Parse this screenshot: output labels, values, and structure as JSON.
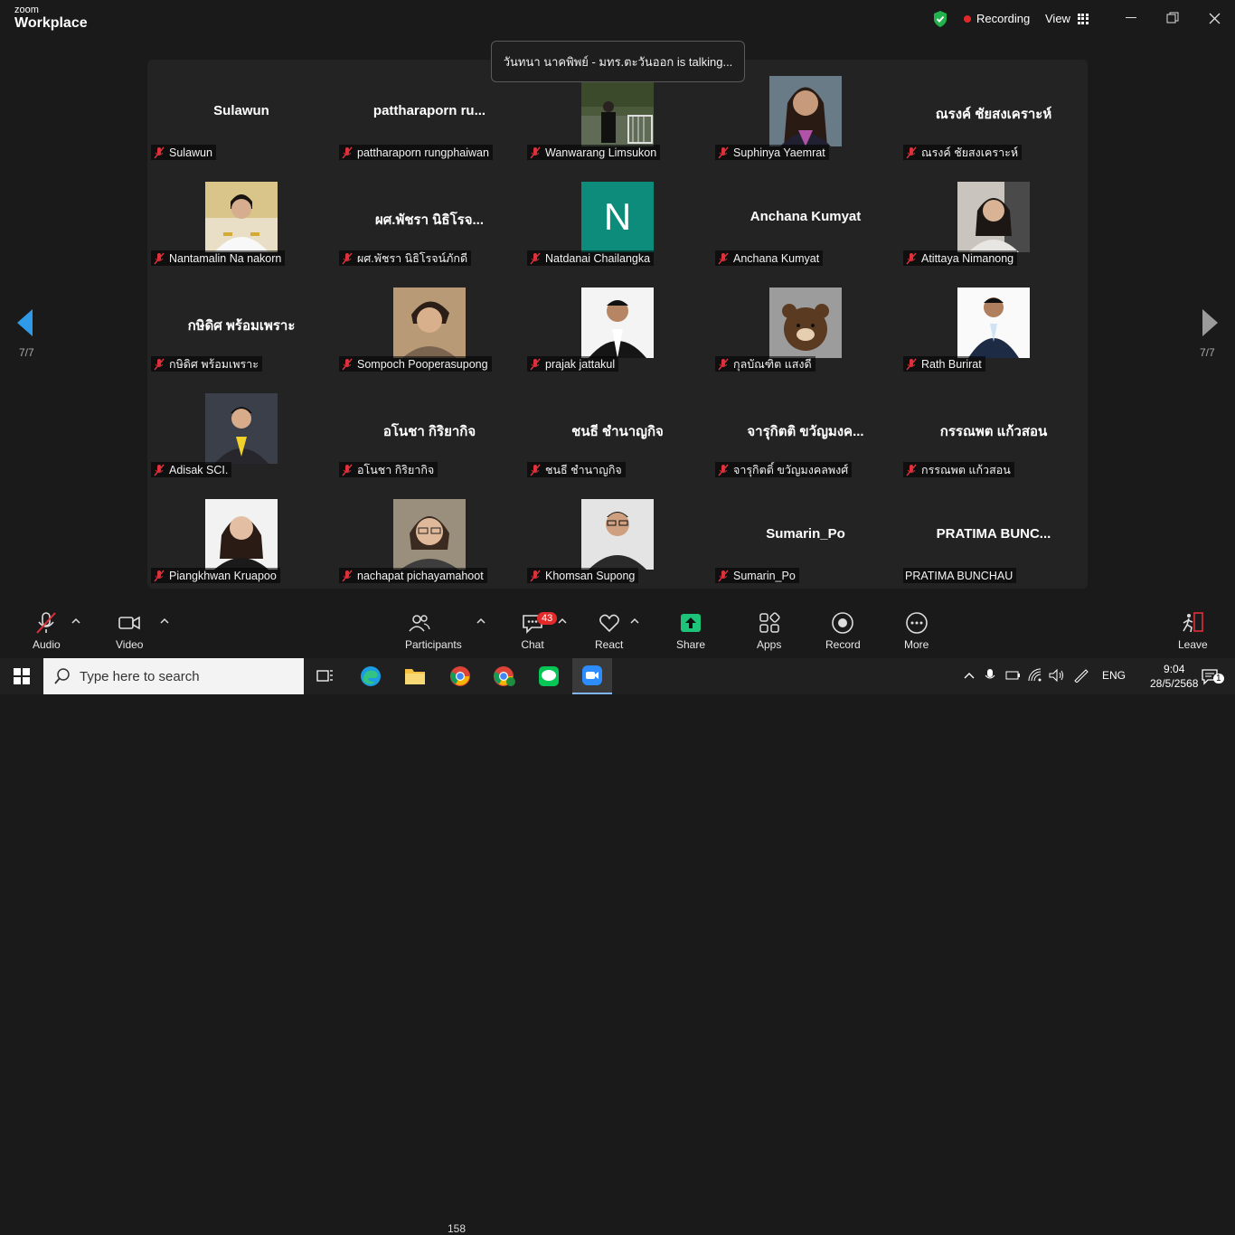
{
  "app": {
    "brand_small": "zoom",
    "brand_big": "Workplace"
  },
  "titlebar": {
    "recording_label": "Recording",
    "view_label": "View"
  },
  "banner": {
    "talking_text": "วันทนา นาคพิพย์ - มทร.ตะวันออก is talking..."
  },
  "gallery": {
    "page_left": "7/7",
    "page_right": "7/7",
    "tiles": [
      {
        "big": "Sulawun",
        "name": "Sulawun"
      },
      {
        "big": "pattharaporn  ru...",
        "name": "pattharaporn rungphaiwan"
      },
      {
        "big": "",
        "name": "Wanwarang Limsukon"
      },
      {
        "big": "",
        "name": "Suphinya Yaemrat"
      },
      {
        "big": "ณรงค์ ชัยสงเคราะห์",
        "name": "ณรงค์ ชัยสงเคราะห์"
      },
      {
        "big": "",
        "name": "Nantamalin Na nakorn"
      },
      {
        "big": "ผศ.พัชรา นิธิโรจ...",
        "name": "ผศ.พัชรา นิธิโรจน์ภักดี"
      },
      {
        "big": "",
        "name": "Natdanai Chailangka"
      },
      {
        "big": "Anchana Kumyat",
        "name": "Anchana Kumyat"
      },
      {
        "big": "",
        "name": "Atittaya Nimanong"
      },
      {
        "big": "กษิดิศ พร้อมเพราะ",
        "name": "กษิดิศ พร้อมเพราะ"
      },
      {
        "big": "",
        "name": "Sompoch Pooperasupong"
      },
      {
        "big": "",
        "name": "prajak jattakul"
      },
      {
        "big": "",
        "name": "กุลบัณฑิต แสงดี"
      },
      {
        "big": "",
        "name": "Rath Burirat"
      },
      {
        "big": "",
        "name": "Adisak SCI."
      },
      {
        "big": "อโนชา กิริยากิจ",
        "name": "อโนชา กิริยากิจ"
      },
      {
        "big": "ชนธี ชำนาญกิจ",
        "name": "ชนธี ชำนาญกิจ"
      },
      {
        "big": "จารุกิตติ ขวัญมงค...",
        "name": "จารุกิตติ์ ขวัญมงคลพงศ์"
      },
      {
        "big": "กรรณพต แก้วสอน",
        "name": "กรรณพต แก้วสอน"
      },
      {
        "big": "",
        "name": "Piangkhwan Kruapoo"
      },
      {
        "big": "",
        "name": "nachapat pichayamahoot"
      },
      {
        "big": "",
        "name": "Khomsan Supong"
      },
      {
        "big": "Sumarin_Po",
        "name": "Sumarin_Po"
      },
      {
        "big": "PRATIMA  BUNC...",
        "name": "PRATIMA BUNCHAU"
      }
    ],
    "natdanai_initial": "N"
  },
  "toolbar": {
    "audio": "Audio",
    "video": "Video",
    "participants": "Participants",
    "participant_count": "158",
    "chat": "Chat",
    "chat_badge": "43",
    "react": "React",
    "share": "Share",
    "apps": "Apps",
    "record": "Record",
    "more": "More",
    "leave": "Leave"
  },
  "taskbar": {
    "search_placeholder": "Type here to search",
    "lang": "ENG",
    "time": "9:04",
    "date": "28/5/2568",
    "notif_count": "1"
  },
  "colors": {
    "accent_green": "#1db954",
    "share_green": "#1ec37a",
    "recording_red": "#e02828",
    "mute_red": "#e0303a",
    "arrow_blue": "#2f9be8"
  }
}
